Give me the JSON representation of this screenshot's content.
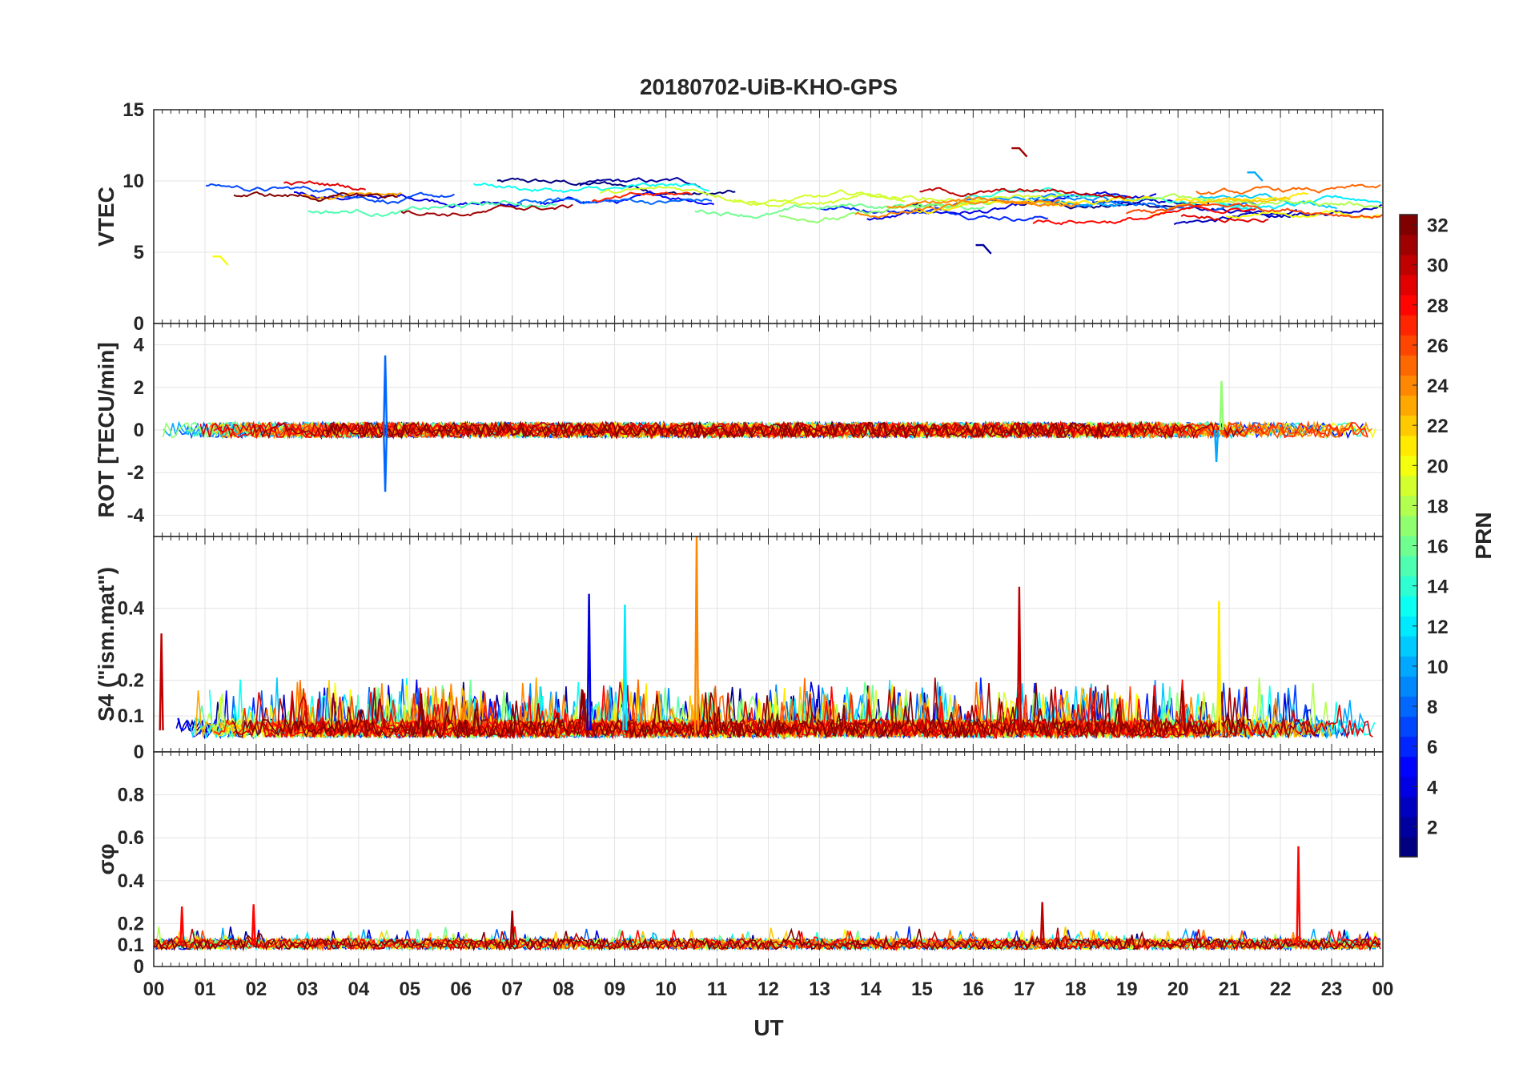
{
  "title": "20180702-UiB-KHO-GPS",
  "xlabel": "UT",
  "x_ticks": [
    "00",
    "01",
    "02",
    "03",
    "04",
    "05",
    "06",
    "07",
    "08",
    "09",
    "10",
    "11",
    "12",
    "13",
    "14",
    "15",
    "16",
    "17",
    "18",
    "19",
    "20",
    "21",
    "22",
    "23",
    "00"
  ],
  "colorbar": {
    "label": "PRN",
    "range": [
      1,
      32
    ],
    "ticks": [
      2,
      4,
      6,
      8,
      10,
      12,
      14,
      16,
      18,
      20,
      22,
      24,
      26,
      28,
      30,
      32
    ],
    "colormap": "jet"
  },
  "chart_data": [
    {
      "type": "line",
      "panel": "vtec",
      "ylabel": "VTEC",
      "xlim": [
        0,
        24
      ],
      "ylim": [
        0,
        15
      ],
      "yticks": [
        0,
        5,
        10,
        15
      ],
      "grid": true,
      "series_note_values": "per-PRN vertical TEC arcs, mostly between 6 and 11 TECU",
      "highlights": [
        {
          "prn": 31,
          "x": 16.9,
          "y": 12.3
        },
        {
          "prn": 10,
          "x": 21.5,
          "y": 10.6
        },
        {
          "prn": 20,
          "x": 1.3,
          "y": 4.7
        },
        {
          "prn": 2,
          "x": 16.2,
          "y": 5.5
        }
      ]
    },
    {
      "type": "line",
      "panel": "rot",
      "ylabel": "ROT [TECU/min]",
      "xlim": [
        0,
        24
      ],
      "ylim": [
        -5,
        5
      ],
      "yticks": [
        -4,
        -2,
        0,
        2,
        4
      ],
      "grid": true,
      "highlights": [
        {
          "prn": 8,
          "x": 4.52,
          "y": 3.5
        },
        {
          "prn": 8,
          "x": 4.52,
          "y": -2.9
        },
        {
          "prn": 17,
          "x": 20.85,
          "y": 2.3
        },
        {
          "prn": 10,
          "x": 20.75,
          "y": -1.5
        }
      ]
    },
    {
      "type": "line",
      "panel": "s4",
      "ylabel": "S4 (\"ism.mat\")",
      "xlim": [
        0,
        24
      ],
      "ylim": [
        0,
        0.6
      ],
      "yticks": [
        0,
        0.1,
        0.2,
        0.4
      ],
      "grid": true,
      "highlights": [
        {
          "prn": 24,
          "x": 10.6,
          "y": 0.6
        },
        {
          "prn": 30,
          "x": 16.9,
          "y": 0.46
        },
        {
          "prn": 4,
          "x": 8.5,
          "y": 0.44
        },
        {
          "prn": 21,
          "x": 20.8,
          "y": 0.42
        },
        {
          "prn": 12,
          "x": 9.2,
          "y": 0.41
        },
        {
          "prn": 30,
          "x": 0.15,
          "y": 0.33
        }
      ]
    },
    {
      "type": "line",
      "panel": "sigma_phi",
      "ylabel": "σφ",
      "xlim": [
        0,
        24
      ],
      "ylim": [
        0,
        1
      ],
      "yticks": [
        0,
        0.1,
        0.2,
        0.4,
        0.6,
        0.8
      ],
      "grid": true,
      "highlights": [
        {
          "prn": 28,
          "x": 22.35,
          "y": 0.56
        },
        {
          "prn": 30,
          "x": 17.35,
          "y": 0.3
        },
        {
          "prn": 28,
          "x": 1.95,
          "y": 0.29
        },
        {
          "prn": 28,
          "x": 0.55,
          "y": 0.28
        },
        {
          "prn": 31,
          "x": 7.0,
          "y": 0.26
        }
      ]
    }
  ]
}
